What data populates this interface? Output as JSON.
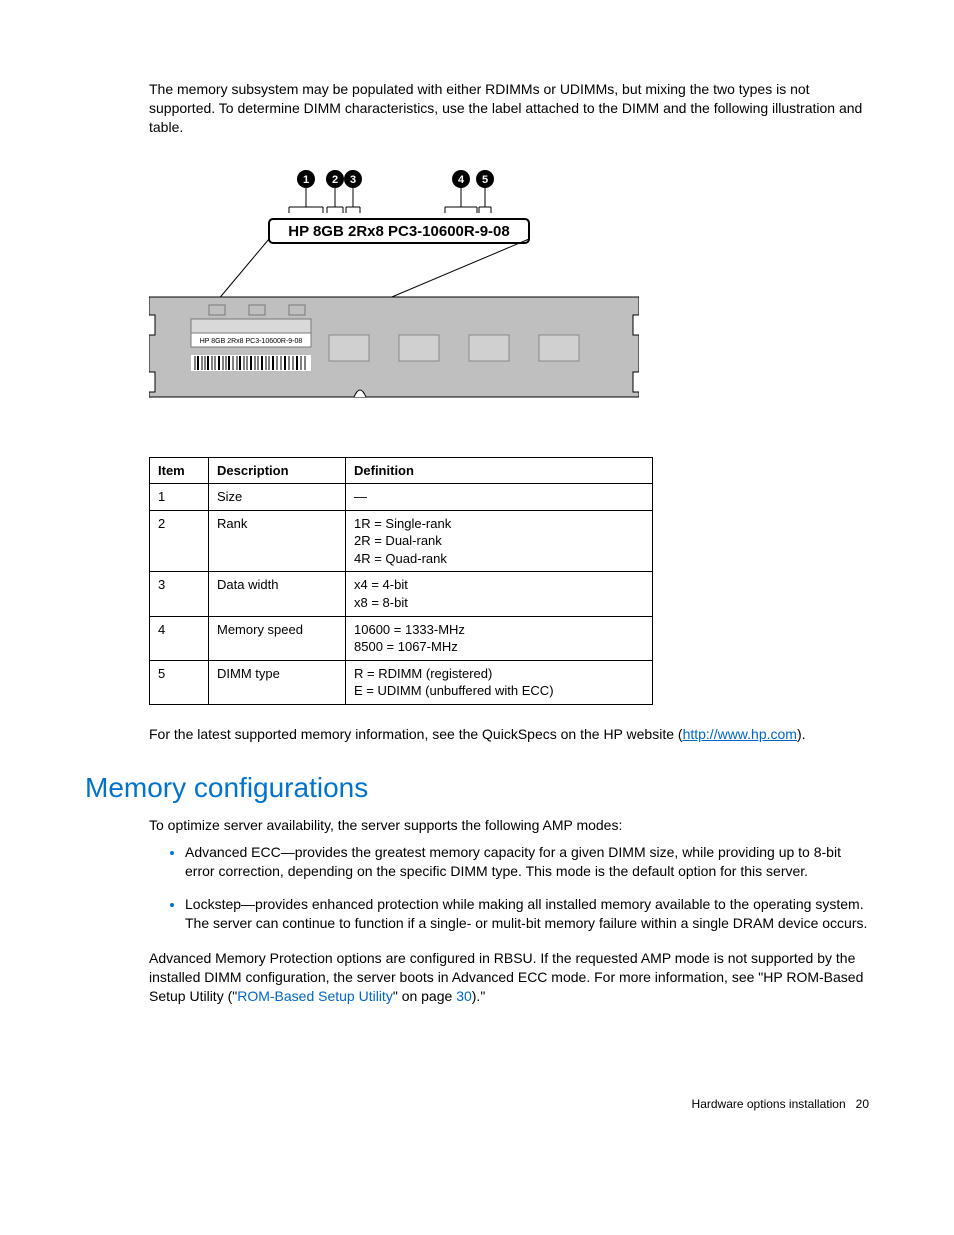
{
  "intro": "The memory subsystem may be populated with either RDIMMs or UDIMMs, but mixing the two types is not supported. To determine DIMM characteristics, use the label attached to the DIMM and the following illustration and table.",
  "diagram": {
    "label": "HP 8GB 2Rx8 PC3-10600R-9-08",
    "smallLabel": "HP 8GB 2Rx8 PC3-10600R-9-08",
    "callouts": [
      "1",
      "2",
      "3",
      "4",
      "5"
    ]
  },
  "table": {
    "headers": {
      "item": "Item",
      "desc": "Description",
      "def": "Definition"
    },
    "rows": [
      {
        "item": "1",
        "desc": "Size",
        "def": "—"
      },
      {
        "item": "2",
        "desc": "Rank",
        "def": "1R = Single-rank\n2R = Dual-rank\n4R = Quad-rank"
      },
      {
        "item": "3",
        "desc": "Data width",
        "def": "x4 = 4-bit\nx8 = 8-bit"
      },
      {
        "item": "4",
        "desc": "Memory speed",
        "def": "10600 = 1333-MHz\n8500 = 1067-MHz"
      },
      {
        "item": "5",
        "desc": "DIMM type",
        "def": "R = RDIMM (registered)\nE = UDIMM (unbuffered with ECC)"
      }
    ]
  },
  "quickspecs_pre": "For the latest supported memory information, see the QuickSpecs on the HP website (",
  "quickspecs_link": "http://www.hp.com",
  "quickspecs_post": ").",
  "section_heading": "Memory configurations",
  "amp_intro": "To optimize server availability, the server supports the following AMP modes:",
  "bullets": [
    "Advanced ECC—provides the greatest memory capacity for a given DIMM size, while providing up to 8-bit error correction, depending on the specific DIMM type. This mode is the default option for this server.",
    "Lockstep—provides enhanced protection while making all installed memory available to the operating system. The server can continue to function if a single- or mulit-bit memory failure within a single DRAM device occurs."
  ],
  "amp_outro_pre": "Advanced Memory Protection options are configured in RBSU. If the requested AMP mode is not supported by the installed DIMM configuration, the server boots in Advanced ECC mode. For more information, see \"HP ROM-Based Setup Utility (\"",
  "amp_outro_link1": "ROM-Based Setup Utility",
  "amp_outro_mid": "\" on page ",
  "amp_outro_link2": "30",
  "amp_outro_post": ").\"",
  "footer_text": "Hardware options installation",
  "footer_page": "20"
}
